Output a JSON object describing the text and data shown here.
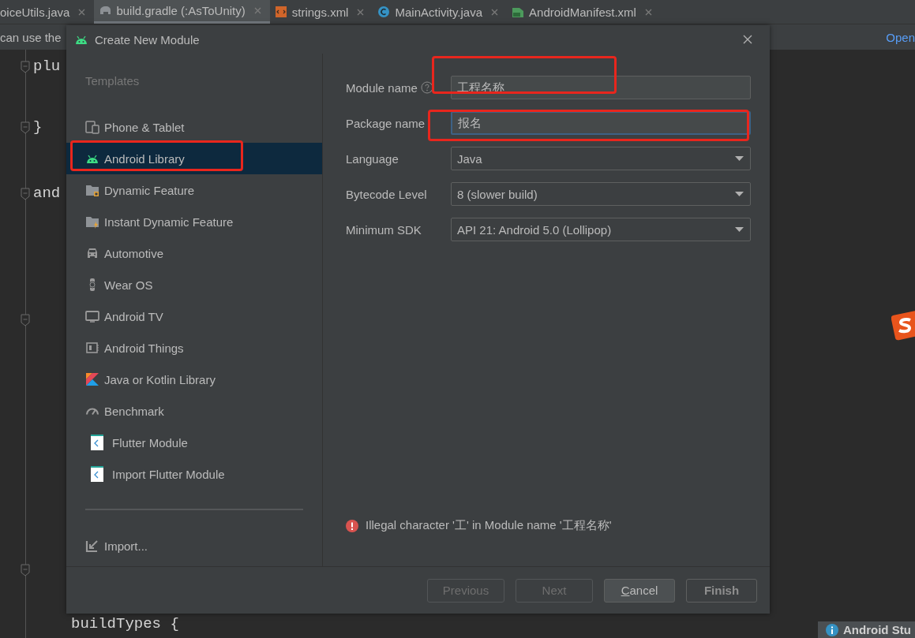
{
  "editor_tabs": [
    {
      "label": "oiceUtils.java",
      "selected": false
    },
    {
      "label": "build.gradle (:AsToUnity)",
      "selected": true
    },
    {
      "label": "strings.xml",
      "selected": false
    },
    {
      "label": "MainActivity.java",
      "selected": false
    },
    {
      "label": "AndroidManifest.xml",
      "selected": false
    }
  ],
  "banner": {
    "text": "can use the",
    "link": "Open"
  },
  "code_lines": [
    "plu",
    "}",
    "and",
    "buildTypes {"
  ],
  "dialog": {
    "title": "Create New Module",
    "templates_heading": "Templates",
    "templates": [
      {
        "label": "Phone & Tablet",
        "selected": false,
        "highlighted": false
      },
      {
        "label": "Android Library",
        "selected": true,
        "highlighted": true
      },
      {
        "label": "Dynamic Feature",
        "selected": false,
        "highlighted": false
      },
      {
        "label": "Instant Dynamic Feature",
        "selected": false,
        "highlighted": false
      },
      {
        "label": "Automotive",
        "selected": false,
        "highlighted": false
      },
      {
        "label": "Wear OS",
        "selected": false,
        "highlighted": false
      },
      {
        "label": "Android TV",
        "selected": false,
        "highlighted": false
      },
      {
        "label": "Android Things",
        "selected": false,
        "highlighted": false
      },
      {
        "label": "Java or Kotlin Library",
        "selected": false,
        "highlighted": false
      },
      {
        "label": "Benchmark",
        "selected": false,
        "highlighted": false
      },
      {
        "label": "Flutter Module",
        "selected": false,
        "highlighted": false
      },
      {
        "label": "Import Flutter Module",
        "selected": false,
        "highlighted": false
      }
    ],
    "import_label": "Import...",
    "fields": [
      {
        "label": "Module name",
        "help": true,
        "kind": "text",
        "value": "工程名称",
        "focused": false,
        "highlighted": true
      },
      {
        "label": "Package name",
        "help": false,
        "kind": "text",
        "value": "报名",
        "focused": true,
        "highlighted": true
      },
      {
        "label": "Language",
        "help": false,
        "kind": "dropdown",
        "value": "Java",
        "focused": false,
        "highlighted": false
      },
      {
        "label": "Bytecode Level",
        "help": false,
        "kind": "dropdown",
        "value": "8 (slower build)",
        "focused": false,
        "highlighted": false
      },
      {
        "label": "Minimum SDK",
        "help": false,
        "kind": "dropdown",
        "value": "API 21: Android 5.0 (Lollipop)",
        "focused": false,
        "highlighted": false
      }
    ],
    "error": "Illegal character '工' in Module name '工程名称'",
    "buttons": [
      {
        "label": "Previous",
        "disabled": true,
        "mnemonic": false,
        "default": false
      },
      {
        "label": "Next",
        "disabled": true,
        "mnemonic": false,
        "default": false
      },
      {
        "label": "Cancel",
        "disabled": false,
        "mnemonic": true,
        "default": false
      },
      {
        "label": "Finish",
        "disabled": false,
        "mnemonic": false,
        "default": true
      }
    ]
  },
  "notification": "Android Stu"
}
